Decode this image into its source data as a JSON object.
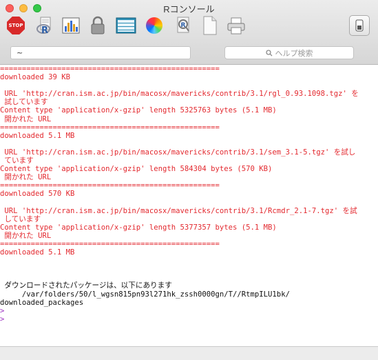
{
  "window": {
    "title": "Rコンソール"
  },
  "toolbar": {
    "stop_label": "STOP",
    "icons": [
      "stop-icon",
      "r-source-icon",
      "chart-icon",
      "lock-icon",
      "table-icon",
      "color-wheel-icon",
      "r-search-icon",
      "document-icon",
      "printer-icon",
      "toggle-icon"
    ]
  },
  "searchbar": {
    "directory": "~",
    "help_placeholder": "ヘルプ検索"
  },
  "console": {
    "lines": [
      {
        "text": "==================================================",
        "kind": "red"
      },
      {
        "text": "downloaded 39 KB",
        "kind": "red"
      },
      {
        "text": "",
        "kind": "red"
      },
      {
        "text": " URL 'http://cran.ism.ac.jp/bin/macosx/mavericks/contrib/3.1/rgl_0.93.1098.tgz' を",
        "kind": "red"
      },
      {
        "text": " 試しています",
        "kind": "red"
      },
      {
        "text": "Content type 'application/x-gzip' length 5325763 bytes (5.1 MB)",
        "kind": "red"
      },
      {
        "text": " 開かれた URL",
        "kind": "red"
      },
      {
        "text": "==================================================",
        "kind": "red"
      },
      {
        "text": "downloaded 5.1 MB",
        "kind": "red"
      },
      {
        "text": "",
        "kind": "red"
      },
      {
        "text": " URL 'http://cran.ism.ac.jp/bin/macosx/mavericks/contrib/3.1/sem_3.1-5.tgz' を試し",
        "kind": "red"
      },
      {
        "text": " ています",
        "kind": "red"
      },
      {
        "text": "Content type 'application/x-gzip' length 584304 bytes (570 KB)",
        "kind": "red"
      },
      {
        "text": " 開かれた URL",
        "kind": "red"
      },
      {
        "text": "==================================================",
        "kind": "red"
      },
      {
        "text": "downloaded 570 KB",
        "kind": "red"
      },
      {
        "text": "",
        "kind": "red"
      },
      {
        "text": " URL 'http://cran.ism.ac.jp/bin/macosx/mavericks/contrib/3.1/Rcmdr_2.1-7.tgz' を試",
        "kind": "red"
      },
      {
        "text": " しています",
        "kind": "red"
      },
      {
        "text": "Content type 'application/x-gzip' length 5377357 bytes (5.1 MB)",
        "kind": "red"
      },
      {
        "text": " 開かれた URL",
        "kind": "red"
      },
      {
        "text": "==================================================",
        "kind": "red"
      },
      {
        "text": "downloaded 5.1 MB",
        "kind": "red"
      },
      {
        "text": "",
        "kind": "red"
      },
      {
        "text": "",
        "kind": "red"
      },
      {
        "text": "",
        "kind": "black"
      },
      {
        "text": " ダウンロードされたパッケージは、以下にあります",
        "kind": "black"
      },
      {
        "text": "     /var/folders/50/l_wgsn815pn93l271hk_zssh0000gn/T//RtmpILU1bk/",
        "kind": "black"
      },
      {
        "text": "downloaded_packages",
        "kind": "black"
      },
      {
        "text": ">",
        "kind": "prompt"
      },
      {
        "text": ">",
        "kind": "prompt"
      }
    ]
  },
  "colors": {
    "error_text": "#e3292f",
    "prompt": "#9b30c0",
    "output_text": "#111111"
  }
}
